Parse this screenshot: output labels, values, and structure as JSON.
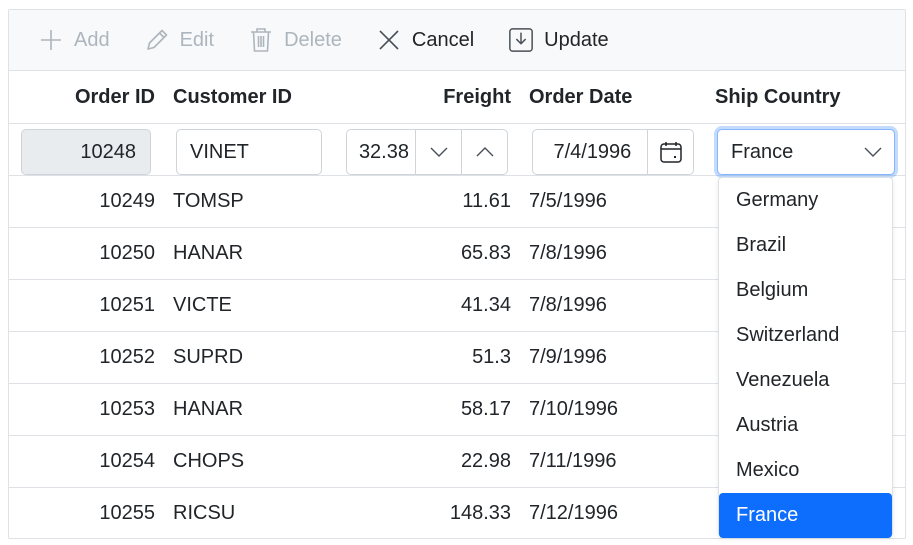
{
  "toolbar": {
    "add": "Add",
    "edit": "Edit",
    "delete": "Delete",
    "cancel": "Cancel",
    "update": "Update"
  },
  "columns": {
    "order_id": "Order ID",
    "customer_id": "Customer ID",
    "freight": "Freight",
    "order_date": "Order Date",
    "ship_country": "Ship Country"
  },
  "edit_row": {
    "order_id": "10248",
    "customer_id": "VINET",
    "freight": "32.38",
    "order_date": "7/4/1996",
    "ship_country": "France"
  },
  "rows": [
    {
      "order_id": "10249",
      "customer_id": "TOMSP",
      "freight": "11.61",
      "order_date": "7/5/1996"
    },
    {
      "order_id": "10250",
      "customer_id": "HANAR",
      "freight": "65.83",
      "order_date": "7/8/1996"
    },
    {
      "order_id": "10251",
      "customer_id": "VICTE",
      "freight": "41.34",
      "order_date": "7/8/1996"
    },
    {
      "order_id": "10252",
      "customer_id": "SUPRD",
      "freight": "51.3",
      "order_date": "7/9/1996"
    },
    {
      "order_id": "10253",
      "customer_id": "HANAR",
      "freight": "58.17",
      "order_date": "7/10/1996"
    },
    {
      "order_id": "10254",
      "customer_id": "CHOPS",
      "freight": "22.98",
      "order_date": "7/11/1996"
    },
    {
      "order_id": "10255",
      "customer_id": "RICSU",
      "freight": "148.33",
      "order_date": "7/12/1996"
    }
  ],
  "country_options": [
    "Germany",
    "Brazil",
    "Belgium",
    "Switzerland",
    "Venezuela",
    "Austria",
    "Mexico",
    "France"
  ],
  "colors": {
    "accent": "#0d6efd",
    "focus_border": "#86b7fe",
    "toolbar_bg": "#f8f9fa",
    "disabled_text": "#adb5bd"
  }
}
